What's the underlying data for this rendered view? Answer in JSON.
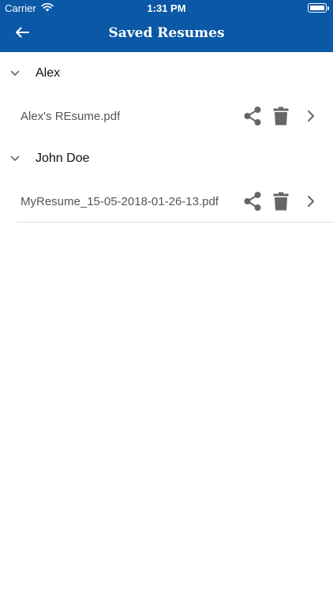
{
  "status_bar": {
    "carrier": "Carrier",
    "time": "1:31 PM"
  },
  "navbar": {
    "title": "Saved Resumes",
    "back_icon": "arrow-left-icon"
  },
  "groups": [
    {
      "name": "Alex",
      "files": [
        {
          "filename": "Alex's REsume.pdf"
        }
      ]
    },
    {
      "name": "John Doe",
      "files": [
        {
          "filename": "MyResume_15-05-2018-01-26-13.pdf"
        }
      ]
    }
  ],
  "colors": {
    "navbar": "#0a58a6",
    "icon_gray": "#666666",
    "filename_text": "#555555"
  }
}
